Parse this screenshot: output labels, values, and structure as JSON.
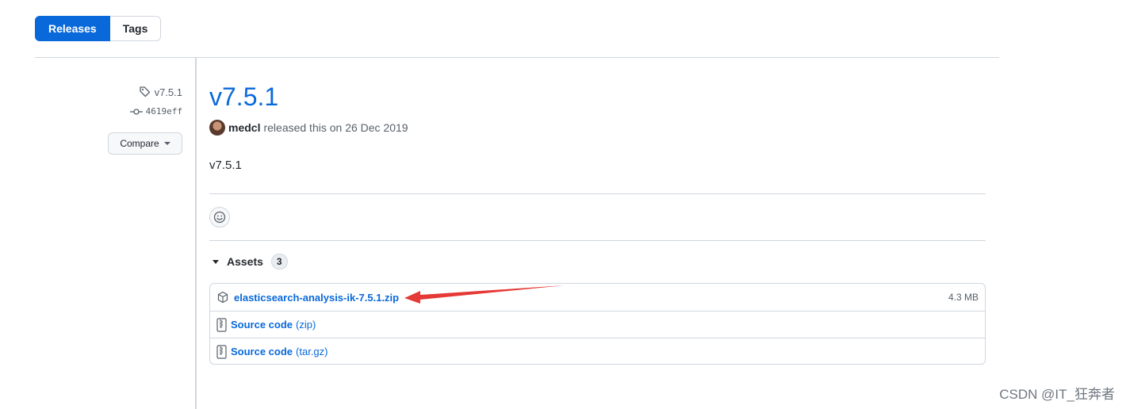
{
  "tabs": {
    "releases_label": "Releases",
    "tags_label": "Tags"
  },
  "sidebar": {
    "tag": "v7.5.1",
    "commit": "4619eff",
    "compare_label": "Compare"
  },
  "release": {
    "title": "v7.5.1",
    "author": "medcl",
    "released_text": "released this on 26 Dec 2019",
    "body": "v7.5.1"
  },
  "assets": {
    "heading": "Assets",
    "count": "3",
    "items": [
      {
        "name": "elasticsearch-analysis-ik-7.5.1.zip",
        "size": "4.3 MB",
        "icon": "package-icon"
      },
      {
        "name": "Source code",
        "suffix": "(zip)",
        "icon": "file-zip-icon"
      },
      {
        "name": "Source code",
        "suffix": "(tar.gz)",
        "icon": "file-zip-icon"
      }
    ]
  },
  "annotation": {
    "color": "#e53935"
  },
  "watermark": "CSDN @IT_狂奔者",
  "colors": {
    "accent": "#0969da",
    "border": "#d0d7de",
    "muted": "#57606a"
  }
}
